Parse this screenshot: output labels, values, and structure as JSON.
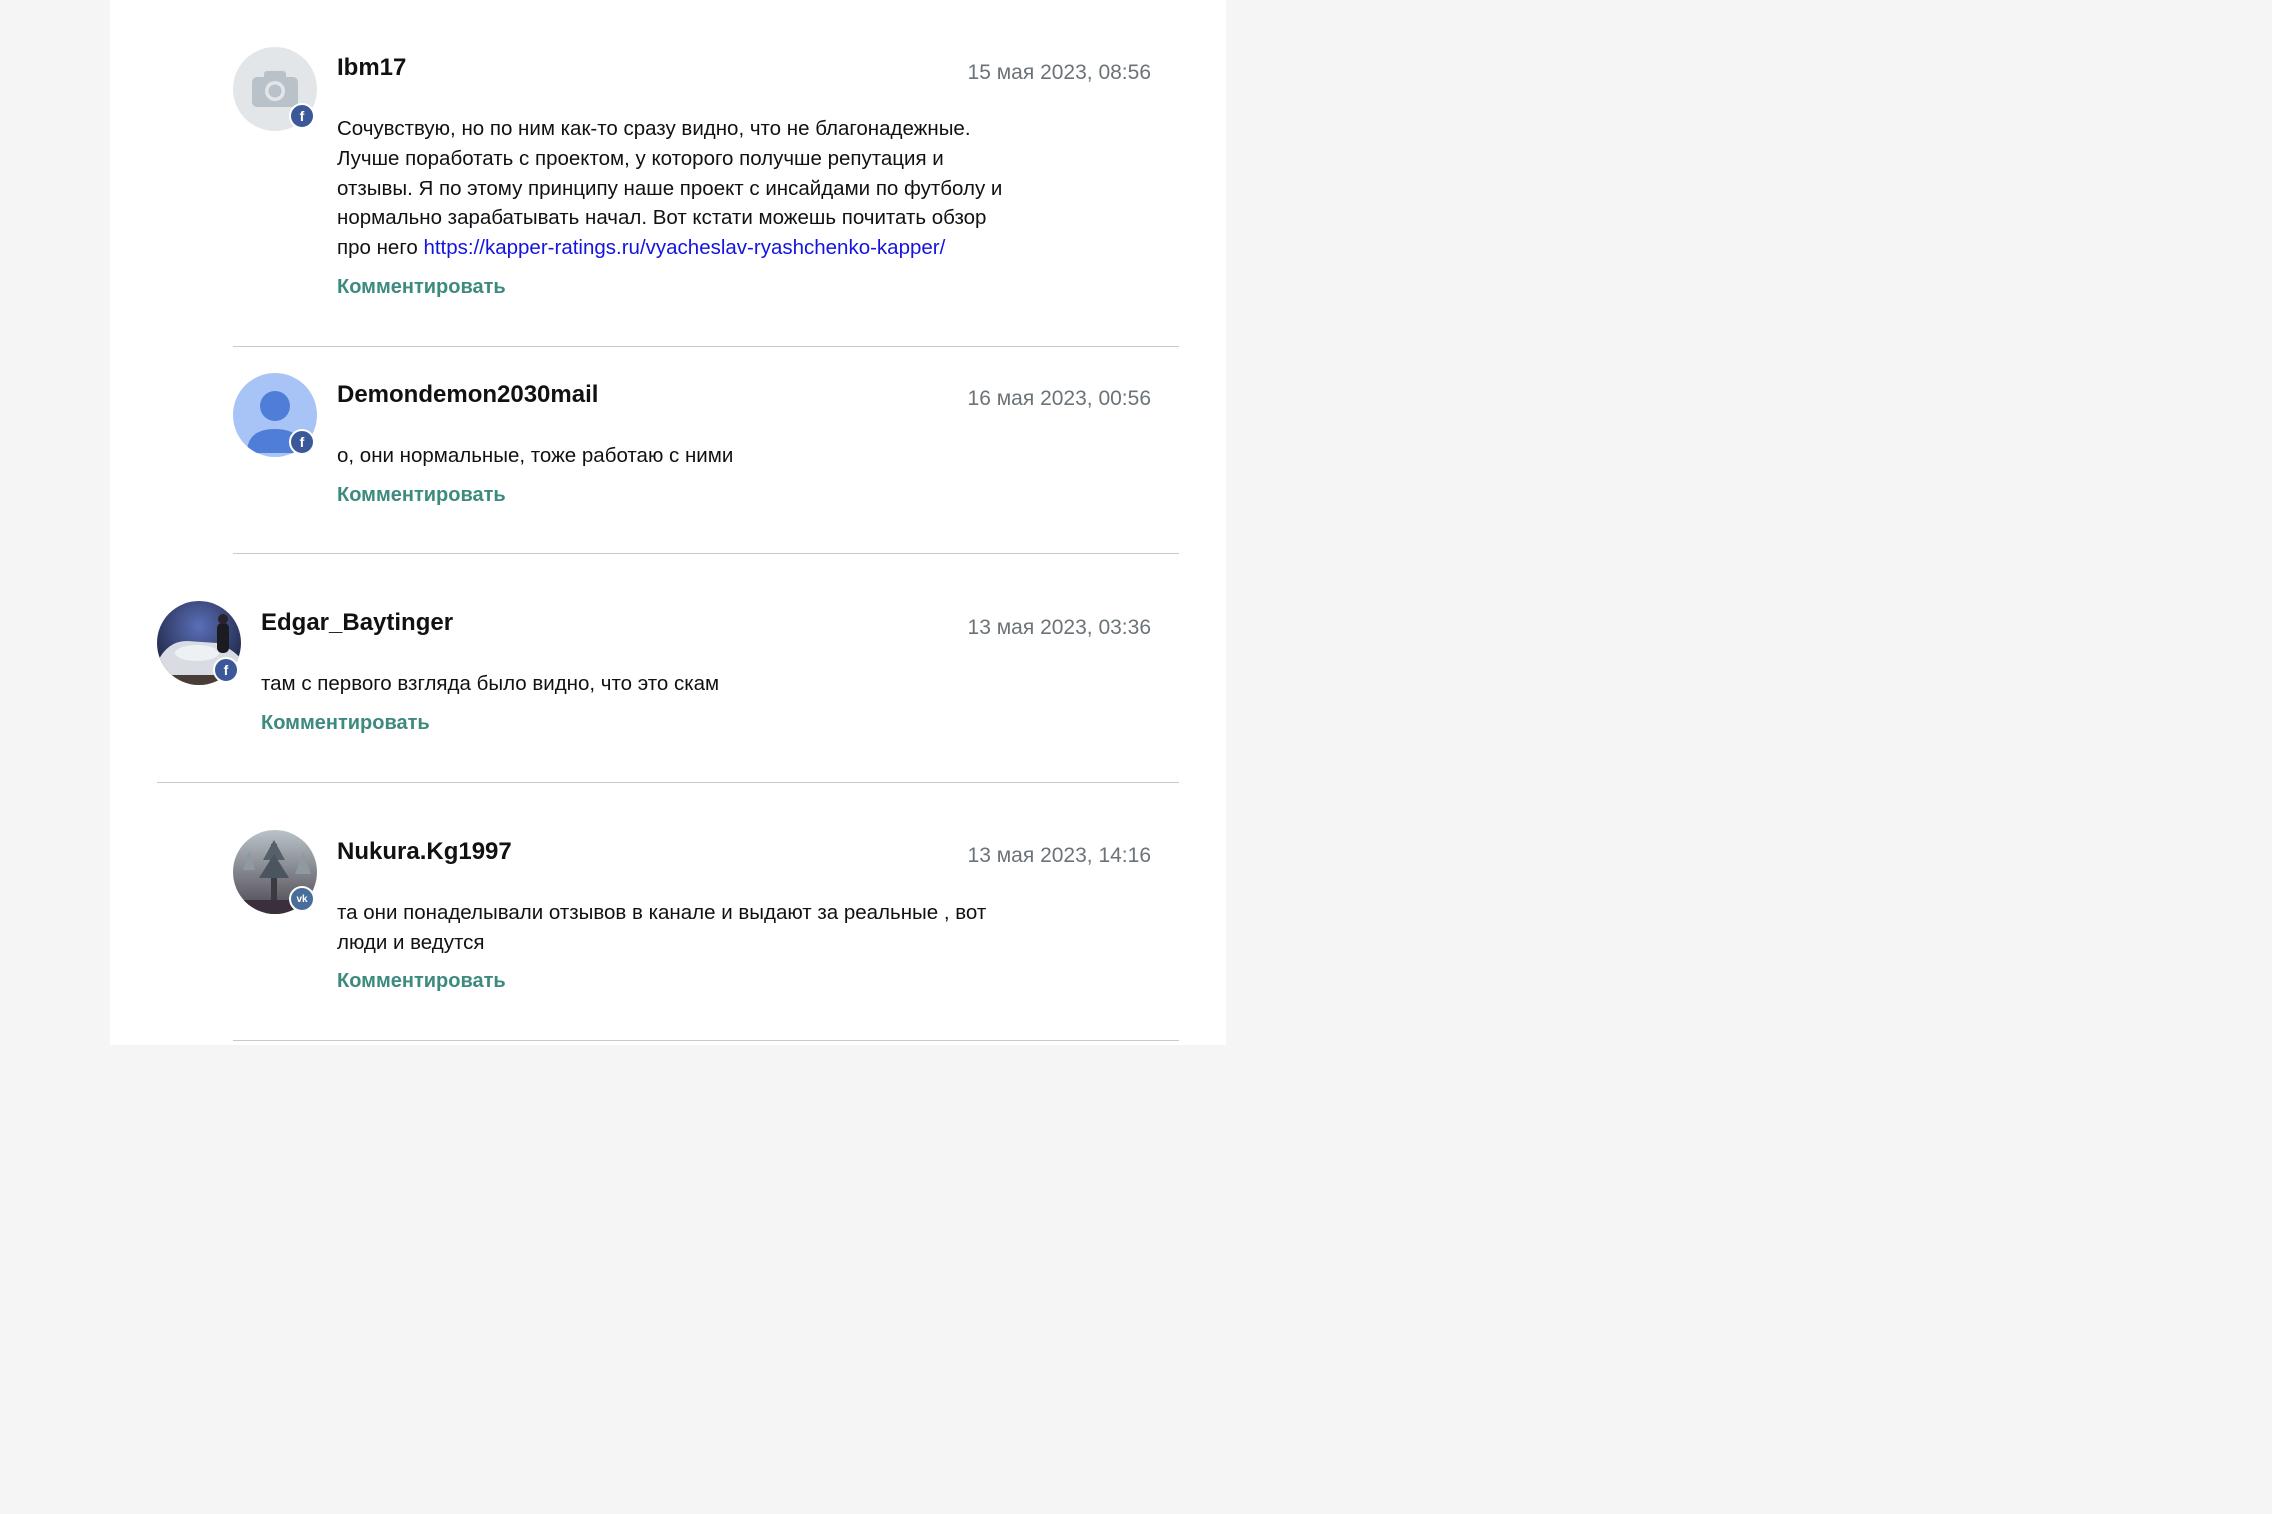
{
  "comments": [
    {
      "author": "Ibm17",
      "date": "15 мая 2023, 08:56",
      "text_lines": [
        "Сочувствую, но по ним как-то сразу видно, что не благонадежные.",
        "Лучше поработать с проектом, у которого получше репутация и",
        "отзывы. Я по этому принципу наше проект с инсайдами по футболу и",
        "нормально зарабатывать начал. Вот кстати можешь почитать обзор"
      ],
      "text_last_prefix": "про него ",
      "link": "https://kapper-ratings.ru/vyacheslav-ryashchenko-kapper/",
      "reply_label": "Комментировать",
      "social": "f",
      "avatar_icon": "camera-icon"
    },
    {
      "author": "Demondemon2030mail",
      "date": "16 мая 2023, 00:56",
      "text": "о, они нормальные, тоже работаю с ними",
      "reply_label": "Комментировать",
      "social": "f",
      "avatar_icon": "user-silhouette-icon"
    },
    {
      "author": "Edgar_Baytinger",
      "date": "13 мая 2023, 03:36",
      "text": "там с первого взгляда было видно, что это скам",
      "reply_label": "Комментировать",
      "social": "f",
      "avatar_icon": "user-photo"
    },
    {
      "author": "Nukura.Kg1997",
      "date": "13 мая 2023, 14:16",
      "text_lines": [
        "та они понаделывали отзывов в канале и выдают за реальные , вот",
        "люди и ведутся"
      ],
      "reply_label": "Комментировать",
      "social": "vk",
      "avatar_icon": "user-photo"
    }
  ],
  "colors": {
    "accent_reply": "#3d8a7f",
    "link": "#1414e0",
    "facebook_badge": "#3b5998",
    "vk_badge": "#4a6e9a"
  }
}
